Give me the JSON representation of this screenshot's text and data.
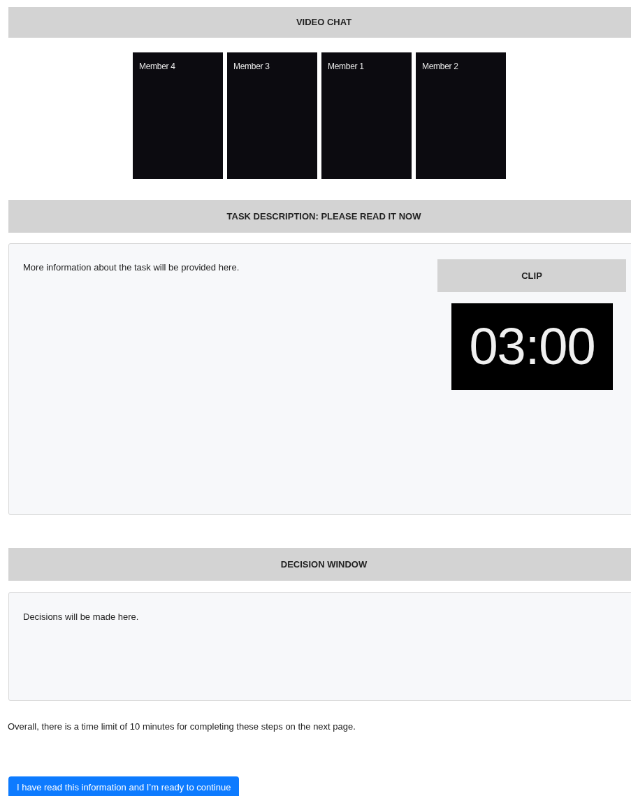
{
  "video_chat": {
    "title": "VIDEO CHAT",
    "members": [
      {
        "label": "Member 4"
      },
      {
        "label": "Member 3"
      },
      {
        "label": "Member 1"
      },
      {
        "label": "Member 2"
      }
    ]
  },
  "task": {
    "title": "TASK DESCRIPTION: PLEASE READ IT NOW",
    "text": "More information about the task will be provided here.",
    "clip": {
      "title": "CLIP",
      "timer": "03:00"
    }
  },
  "decision": {
    "title": "DECISION WINDOW",
    "text": "Decisions will be made here."
  },
  "note": "Overall, there is a time limit of 10 minutes for completing these steps on the next page.",
  "continue_button": "I have read this information and I’m ready to continue"
}
